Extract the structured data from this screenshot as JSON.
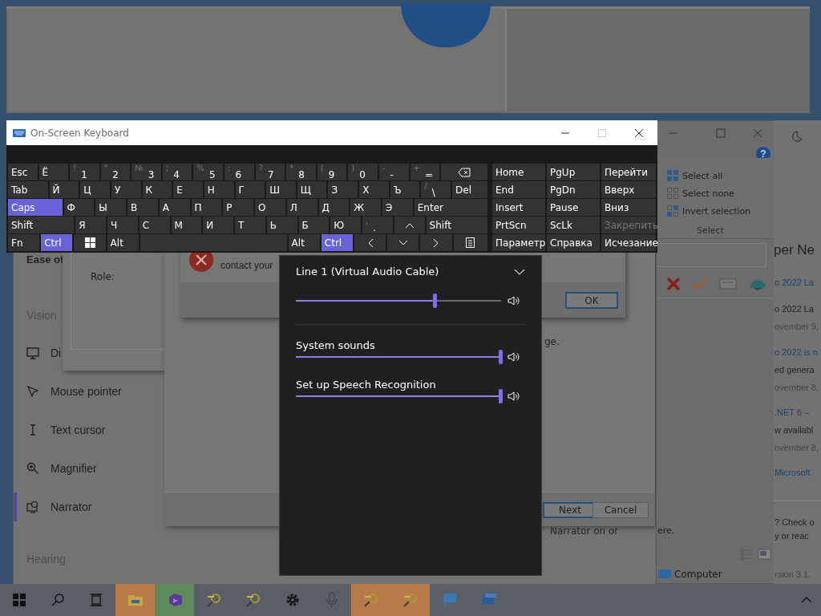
{
  "settings": {
    "heading": "Ease of",
    "sections": [
      {
        "title": "Vision",
        "items": [
          {
            "label": "Di",
            "selected": false
          },
          {
            "label": "Mouse pointer",
            "selected": false
          },
          {
            "label": "Text cursor",
            "selected": false
          },
          {
            "label": "Magnifier",
            "selected": false
          },
          {
            "label": "Narrator",
            "selected": true
          }
        ]
      },
      {
        "title": "Hearing"
      }
    ],
    "description": "Narrator on or"
  },
  "properties_dialog": {
    "field_label": "Role:"
  },
  "wizard_dialog": {
    "text": "ge.",
    "buttons": [
      {
        "label": "Next",
        "focused": true
      },
      {
        "label": "Cancel",
        "focused": false
      }
    ]
  },
  "error_dialog": {
    "message": "contact your",
    "button": "OK"
  },
  "explorer": {
    "help": "?",
    "select_commands": [
      "Select all",
      "Select none",
      "Invert selection"
    ],
    "group": "Select",
    "status_text": "ere.",
    "nav_item": "Computer"
  },
  "browser": {
    "heading": "per Ne",
    "lines": [
      {
        "text": "o 2022 La",
        "kind": "link"
      },
      {
        "text": "o 2022 La",
        "kind": "text"
      },
      {
        "text": "ovember 9,",
        "kind": "date"
      },
      {
        "text": "o 2022 is n",
        "kind": "link"
      },
      {
        "text": "ed genera",
        "kind": "text"
      },
      {
        "text": "ovember 8,",
        "kind": "date"
      },
      {
        "text": ".NET 6 –",
        "kind": "link"
      },
      {
        "text": "w availabl",
        "kind": "text"
      },
      {
        "text": "ovember 8,",
        "kind": "date"
      },
      {
        "text": "Microsoft",
        "kind": "link"
      }
    ],
    "footer": [
      "? Check o",
      "y or reac"
    ],
    "version": "rsion 3.1."
  },
  "keyboard": {
    "title": "On-Screen Keyboard",
    "rows": [
      [
        {
          "label": "Esc",
          "pressed": false
        },
        {
          "label": "Ё",
          "pressed": false
        },
        {
          "label": "1",
          "shift": "!",
          "pressed": false
        },
        {
          "label": "2",
          "shift": "\"",
          "pressed": false
        },
        {
          "label": "3",
          "shift": "№",
          "pressed": false
        },
        {
          "label": "4",
          "shift": ";",
          "pressed": false
        },
        {
          "label": "5",
          "shift": "%",
          "pressed": false
        },
        {
          "label": "6",
          "shift": ":",
          "pressed": false
        },
        {
          "label": "7",
          "shift": "?",
          "pressed": false
        },
        {
          "label": "8",
          "shift": "*",
          "pressed": false
        },
        {
          "label": "9",
          "shift": "(",
          "pressed": false
        },
        {
          "label": "0",
          "shift": ")",
          "pressed": false
        },
        {
          "label": "-",
          "shift": "-",
          "pressed": false
        },
        {
          "label": "=",
          "shift": "+",
          "pressed": false
        },
        {
          "pressed": false
        }
      ],
      [
        {
          "label": "Tab",
          "pressed": false
        },
        {
          "label": "Й",
          "pressed": false
        },
        {
          "label": "Ц",
          "pressed": false
        },
        {
          "label": "У",
          "pressed": false
        },
        {
          "label": "К",
          "pressed": false
        },
        {
          "label": "Е",
          "pressed": false
        },
        {
          "label": "Н",
          "pressed": false
        },
        {
          "label": "Г",
          "pressed": false
        },
        {
          "label": "Ш",
          "pressed": false
        },
        {
          "label": "Щ",
          "pressed": false
        },
        {
          "label": "З",
          "pressed": false
        },
        {
          "label": "Х",
          "pressed": false
        },
        {
          "label": "Ъ",
          "pressed": false
        },
        {
          "label": "\\",
          "shift": "/",
          "pressed": false
        },
        {
          "label": "Del",
          "pressed": false
        }
      ],
      [
        {
          "label": "Caps",
          "pressed": true
        },
        {
          "label": "Ф",
          "pressed": false
        },
        {
          "label": "Ы",
          "pressed": false
        },
        {
          "label": "В",
          "pressed": false
        },
        {
          "label": "А",
          "pressed": false
        },
        {
          "label": "П",
          "pressed": false
        },
        {
          "label": "Р",
          "pressed": false
        },
        {
          "label": "О",
          "pressed": false
        },
        {
          "label": "Л",
          "pressed": false
        },
        {
          "label": "Д",
          "pressed": false
        },
        {
          "label": "Ж",
          "pressed": false
        },
        {
          "label": "Э",
          "pressed": false
        },
        {
          "label": "Enter",
          "pressed": false
        }
      ],
      [
        {
          "label": "Shift",
          "pressed": false
        },
        {
          "label": "Я",
          "pressed": false
        },
        {
          "label": "Ч",
          "pressed": false
        },
        {
          "label": "С",
          "pressed": false
        },
        {
          "label": "М",
          "pressed": false
        },
        {
          "label": "И",
          "pressed": false
        },
        {
          "label": "Т",
          "pressed": false
        },
        {
          "label": "Ь",
          "pressed": false
        },
        {
          "label": "Б",
          "pressed": false
        },
        {
          "label": "Ю",
          "pressed": false
        },
        {
          "label": ".",
          "shift": ",",
          "pressed": false
        },
        {
          "pressed": false
        },
        {
          "label": "Shift",
          "pressed": false
        }
      ],
      [
        {
          "label": "Fn",
          "pressed": false
        },
        {
          "label": "Ctrl",
          "pressed": true
        },
        {
          "pressed": false
        },
        {
          "label": "Alt",
          "pressed": false
        },
        {
          "pressed": false
        },
        {
          "label": "Alt",
          "pressed": false
        },
        {
          "label": "Ctrl",
          "pressed": true
        },
        {
          "pressed": false
        },
        {
          "pressed": false
        },
        {
          "pressed": false
        },
        {
          "pressed": false
        }
      ]
    ],
    "nav_rows": [
      [
        {
          "label": "Home",
          "disabled": false
        },
        {
          "label": "PgUp",
          "disabled": false
        },
        {
          "label": "Перейти",
          "disabled": false
        }
      ],
      [
        {
          "label": "End",
          "disabled": false
        },
        {
          "label": "PgDn",
          "disabled": false
        },
        {
          "label": "Вверх",
          "disabled": false
        }
      ],
      [
        {
          "label": "Insert",
          "disabled": false
        },
        {
          "label": "Pause",
          "disabled": false
        },
        {
          "label": "Вниз",
          "disabled": false
        }
      ],
      [
        {
          "label": "PrtScn",
          "disabled": false
        },
        {
          "label": "ScLk",
          "disabled": false
        },
        {
          "label": "Закрепить",
          "disabled": true
        }
      ],
      [
        {
          "label": "Параметр",
          "disabled": false
        },
        {
          "label": "Справка",
          "disabled": false
        },
        {
          "label": "Исчезание",
          "disabled": false
        }
      ]
    ]
  },
  "volume_mixer": {
    "device": {
      "name": "Line 1 (Virtual Audio Cable)",
      "level": 0.68
    },
    "apps": [
      {
        "name": "System sounds",
        "level": 1
      },
      {
        "name": "Set up Speech Recognition",
        "level": 1
      }
    ]
  },
  "taskbar": {
    "apps": [
      {
        "highlighted": true,
        "color": "#b97a4a"
      },
      {
        "highlighted": true,
        "color": "#5e8a5e"
      },
      {
        "highlighted": false
      },
      {
        "highlighted": false
      },
      {
        "highlighted": false
      },
      {
        "highlighted": false
      },
      {
        "highlighted": true,
        "color": "#b97a4a"
      },
      {
        "highlighted": true,
        "color": "#b97a4a"
      },
      {
        "highlighted": false
      },
      {
        "highlighted": false
      }
    ]
  }
}
